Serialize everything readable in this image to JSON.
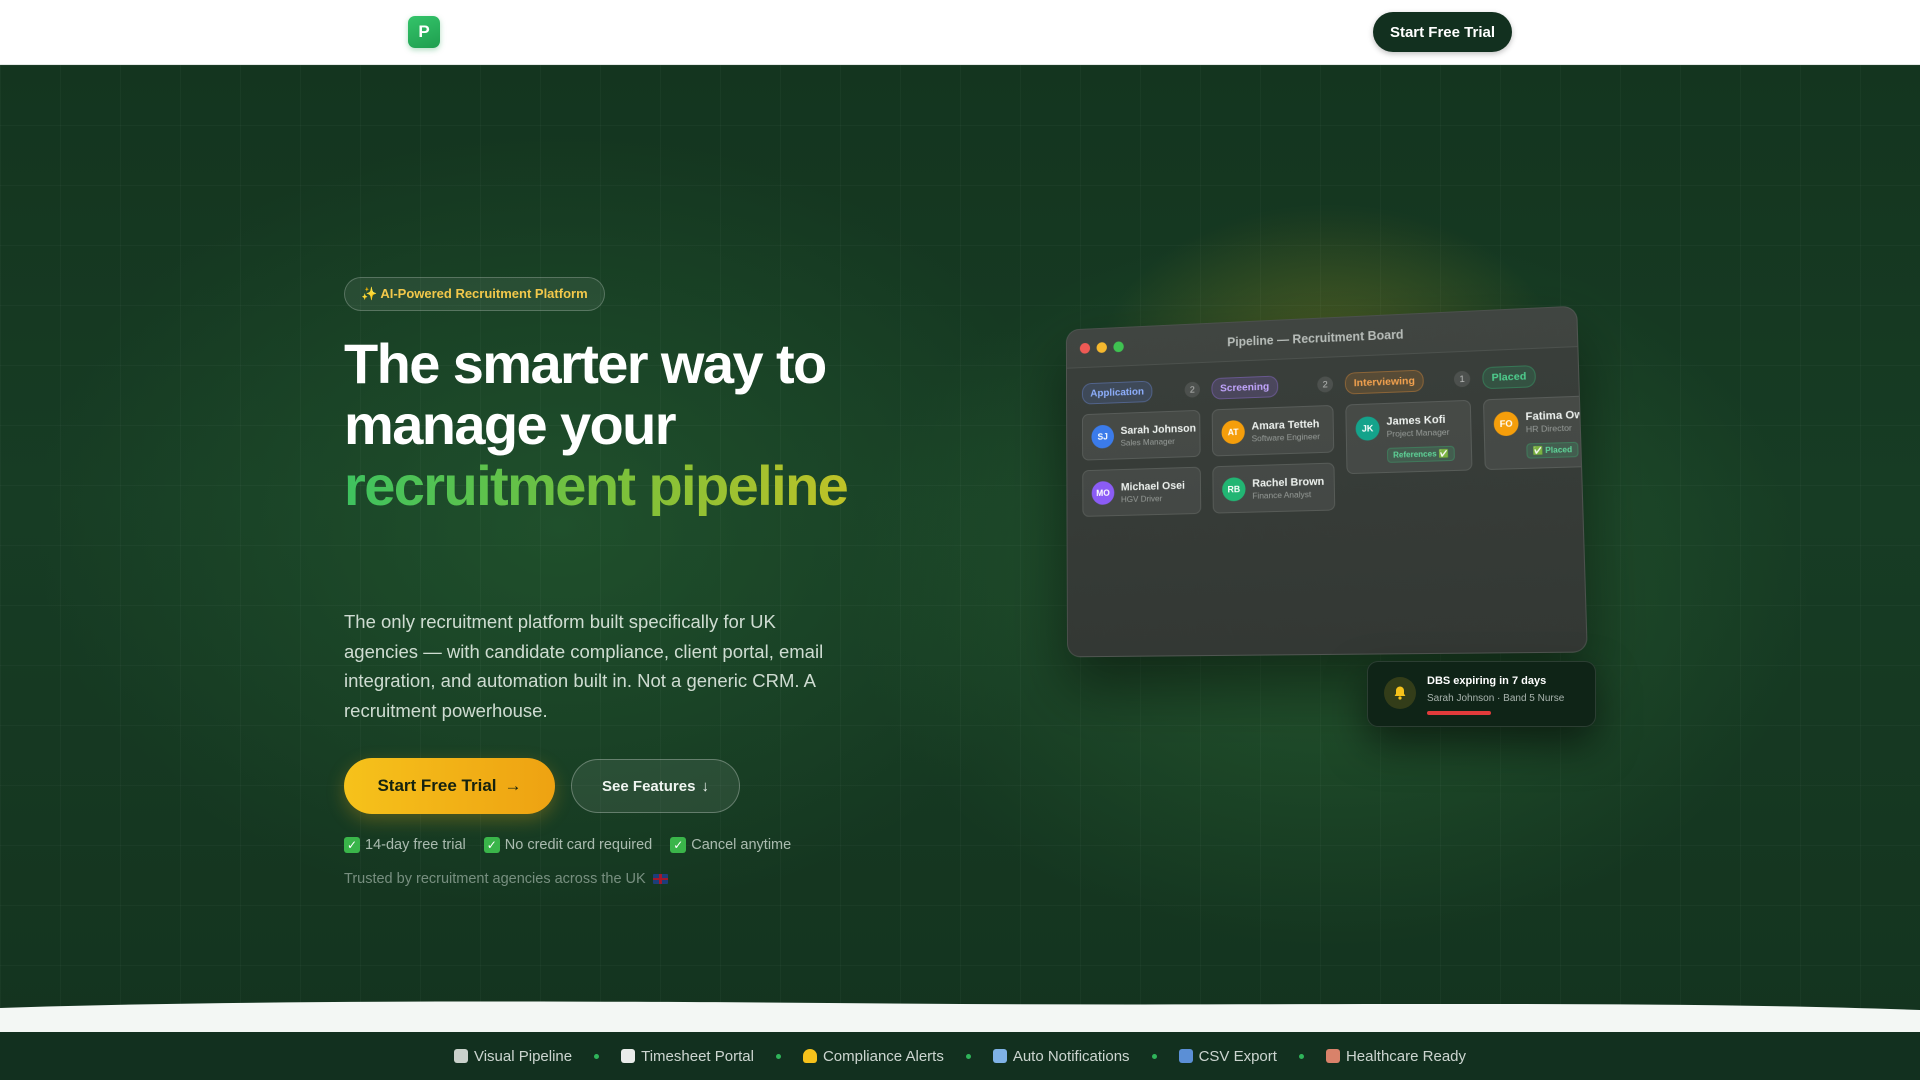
{
  "nav": {
    "logo_letter": "P",
    "cta_label": "Start Free Trial"
  },
  "hero": {
    "badge_text": "✨ AI-Powered Recruitment Platform",
    "headline_line1": "The smarter way to",
    "headline_line2": "manage your",
    "headline_highlight": "recruitment pipeline",
    "subtext": "The only recruitment platform built specifically for UK agencies — with candidate compliance, client portal, email integration, and automation built in. Not a generic CRM. A recruitment powerhouse.",
    "primary_cta": "Start Free Trial",
    "primary_cta_arrow": "→",
    "secondary_cta": "See Features",
    "secondary_cta_arrow": "↓",
    "perks": [
      "14-day free trial",
      "No credit card required",
      "Cancel anytime"
    ],
    "trusted_text": "Trusted by recruitment agencies across the UK"
  },
  "board": {
    "title": "Pipeline — Recruitment Board",
    "columns": [
      {
        "stage": "Application",
        "count": "2",
        "cards": [
          {
            "initials": "SJ",
            "name": "Sarah Johnson",
            "role": "Sales Manager",
            "color": "#3b7bea"
          },
          {
            "initials": "MO",
            "name": "Michael Osei",
            "role": "HGV Driver",
            "color": "#8b5cf6"
          }
        ]
      },
      {
        "stage": "Screening",
        "count": "2",
        "cards": [
          {
            "initials": "AT",
            "name": "Amara Tetteh",
            "role": "Software Engineer",
            "color": "#f59e0b"
          },
          {
            "initials": "RB",
            "name": "Rachel Brown",
            "role": "Finance Analyst",
            "color": "#22b573"
          }
        ]
      },
      {
        "stage": "Interviewing",
        "count": "1",
        "cards": [
          {
            "initials": "JK",
            "name": "James Kofi",
            "role": "Project Manager",
            "color": "#14a38b",
            "tag": "References ✅"
          }
        ]
      },
      {
        "stage": "Placed",
        "count": "",
        "cards": [
          {
            "initials": "FO",
            "name": "Fatima Owu",
            "role": "HR Director",
            "color": "#f59e0b",
            "tag": "✅ Placed"
          }
        ]
      }
    ]
  },
  "notification": {
    "title": "DBS expiring in 7 days",
    "subtitle": "Sarah Johnson · Band 5 Nurse",
    "icon": "bell-icon"
  },
  "ticker": [
    {
      "label": "Visual Pipeline",
      "icon": "clipboard-icon",
      "color": "#c9d1cb"
    },
    {
      "label": "Timesheet Portal",
      "icon": "calendar-icon",
      "color": "#e9ecea"
    },
    {
      "label": "Compliance Alerts",
      "icon": "bell-icon",
      "color": "#f6c21b"
    },
    {
      "label": "Auto Notifications",
      "icon": "email-icon",
      "color": "#7fb2e6"
    },
    {
      "label": "CSV Export",
      "icon": "chart-icon",
      "color": "#5b8fd6"
    },
    {
      "label": "Healthcare Ready",
      "icon": "hospital-icon",
      "color": "#d9826a"
    }
  ],
  "colors": {
    "brand_green": "#1f9e4f",
    "dark_green": "#12301f",
    "accent_yellow": "#f6c21b",
    "alert_red": "#e23b3b"
  }
}
